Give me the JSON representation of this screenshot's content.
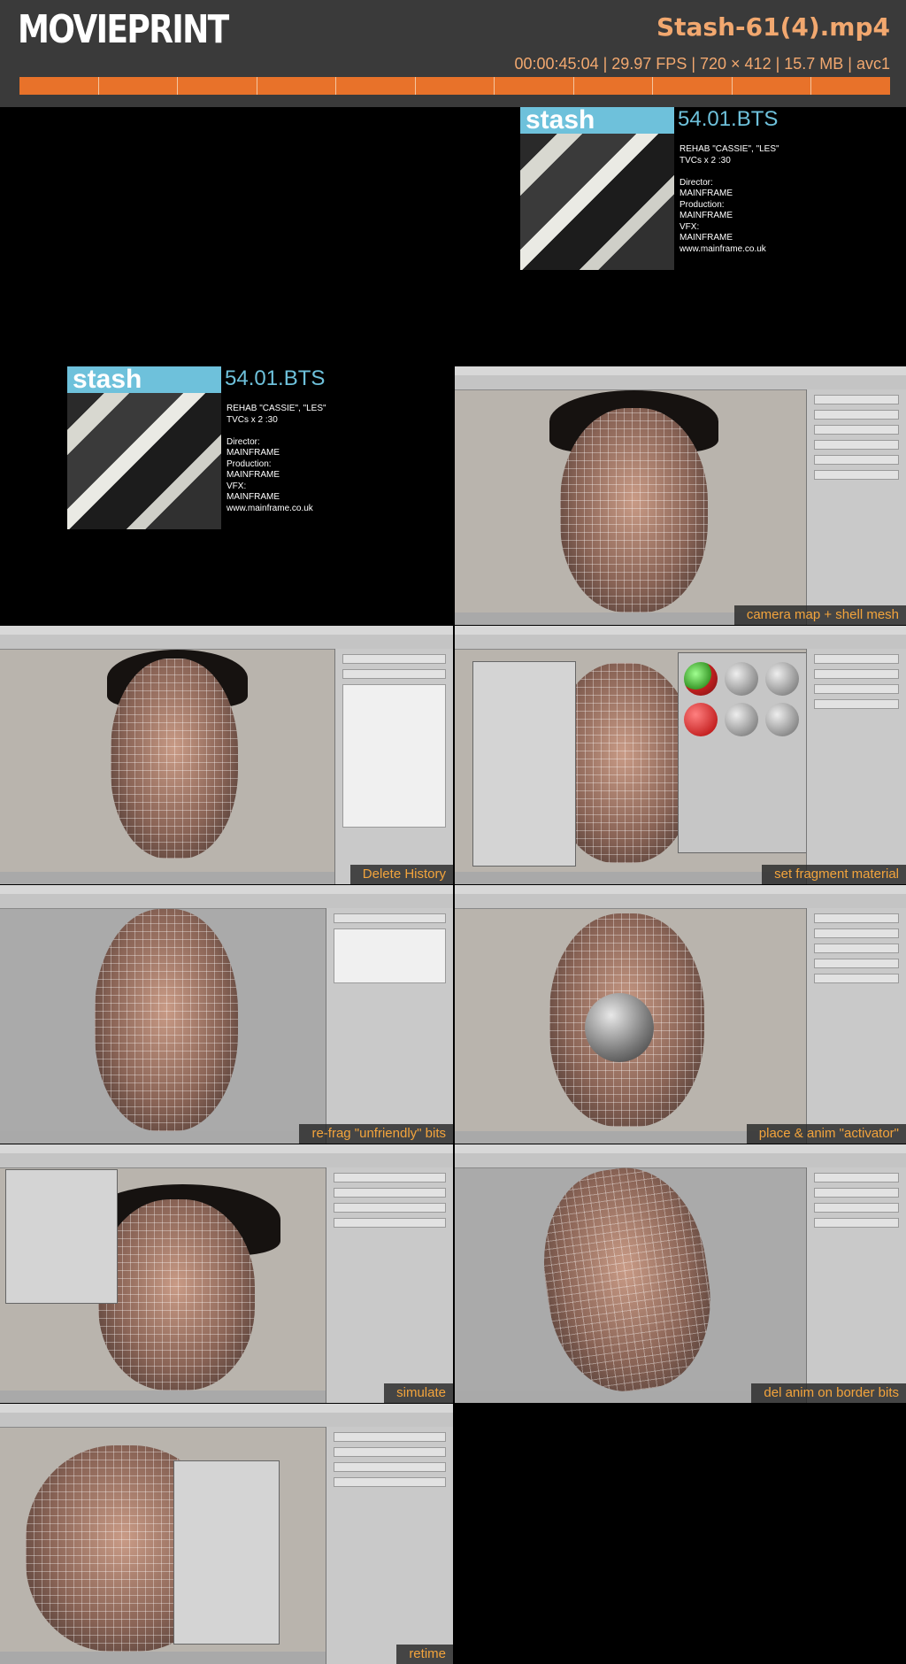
{
  "header": {
    "logo": "MOVIEPRINT",
    "filename": "Stash-61(4).mp4",
    "meta": "00:00:45:04 | 29.97 FPS | 720 × 412 | 15.7 MB | avc1",
    "timeline_segments": 11
  },
  "colors": {
    "header_bg": "#3a3a3a",
    "accent": "#e8722a",
    "caption_text": "#f3a43c",
    "stash_blue": "#6ec1db"
  },
  "stash_card": {
    "logo": "stash",
    "code": "54.01.BTS",
    "lines": "REHAB \"CASSIE\", \"LES\"\nTVCs x 2 :30\n\nDirector:\nMAINFRAME\nProduction:\nMAINFRAME\nVFX:\nMAINFRAME\nwww.mainframe.co.uk"
  },
  "frames": [
    {
      "caption": ""
    },
    {
      "caption": ""
    },
    {
      "caption": "camera map + shell mesh"
    },
    {
      "caption": "Delete History"
    },
    {
      "caption": "set fragment material"
    },
    {
      "caption": "re-frag \"unfriendly\" bits"
    },
    {
      "caption": "place & anim \"activator\""
    },
    {
      "caption": "simulate"
    },
    {
      "caption": "del anim on border bits"
    },
    {
      "caption": "retime"
    }
  ]
}
